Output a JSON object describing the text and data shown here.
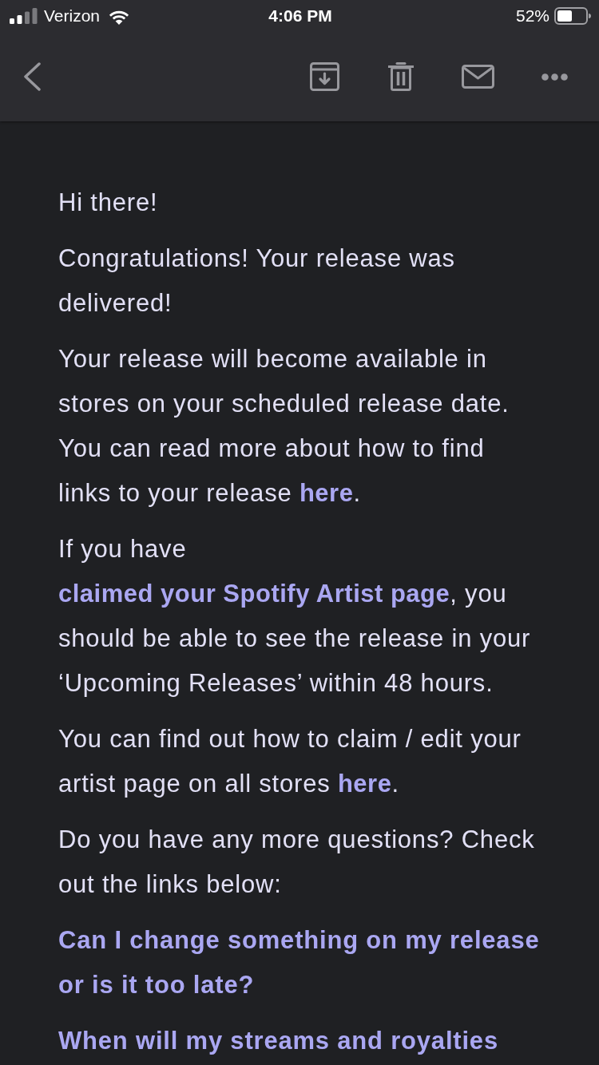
{
  "status_bar": {
    "carrier": "Verizon",
    "time": "4:06 PM",
    "battery": "52%"
  },
  "message": {
    "paragraphs": [
      {
        "kind": "text",
        "parts": [
          {
            "kind": "text",
            "text": "Hi there!"
          }
        ]
      },
      {
        "kind": "text",
        "parts": [
          {
            "kind": "text",
            "text": "Congratulations! Your release was delivered!"
          }
        ]
      },
      {
        "kind": "text",
        "parts": [
          {
            "kind": "text",
            "text": "Your release will become available in stores on your scheduled release date. You can read more about how to find links to your release "
          },
          {
            "kind": "link",
            "text": "here"
          },
          {
            "kind": "text",
            "text": "."
          }
        ]
      },
      {
        "kind": "text",
        "parts": [
          {
            "kind": "text",
            "text": "If you have "
          },
          {
            "kind": "link",
            "text": "claimed your Spotify Artist page"
          },
          {
            "kind": "text",
            "text": ", you should be able to see the release in your ‘Upcoming Releases’ within 48 hours."
          }
        ]
      },
      {
        "kind": "text",
        "parts": [
          {
            "kind": "text",
            "text": "You can find out how to claim / edit your artist page on all stores "
          },
          {
            "kind": "link",
            "text": "here"
          },
          {
            "kind": "text",
            "text": "."
          }
        ]
      },
      {
        "kind": "text",
        "parts": [
          {
            "kind": "text",
            "text": "Do you have any more questions? Check out the links below:"
          }
        ]
      },
      {
        "kind": "link",
        "text": "Can I change something on my release or is it too late?"
      },
      {
        "kind": "link",
        "text": "When will my streams and royalties"
      }
    ]
  }
}
